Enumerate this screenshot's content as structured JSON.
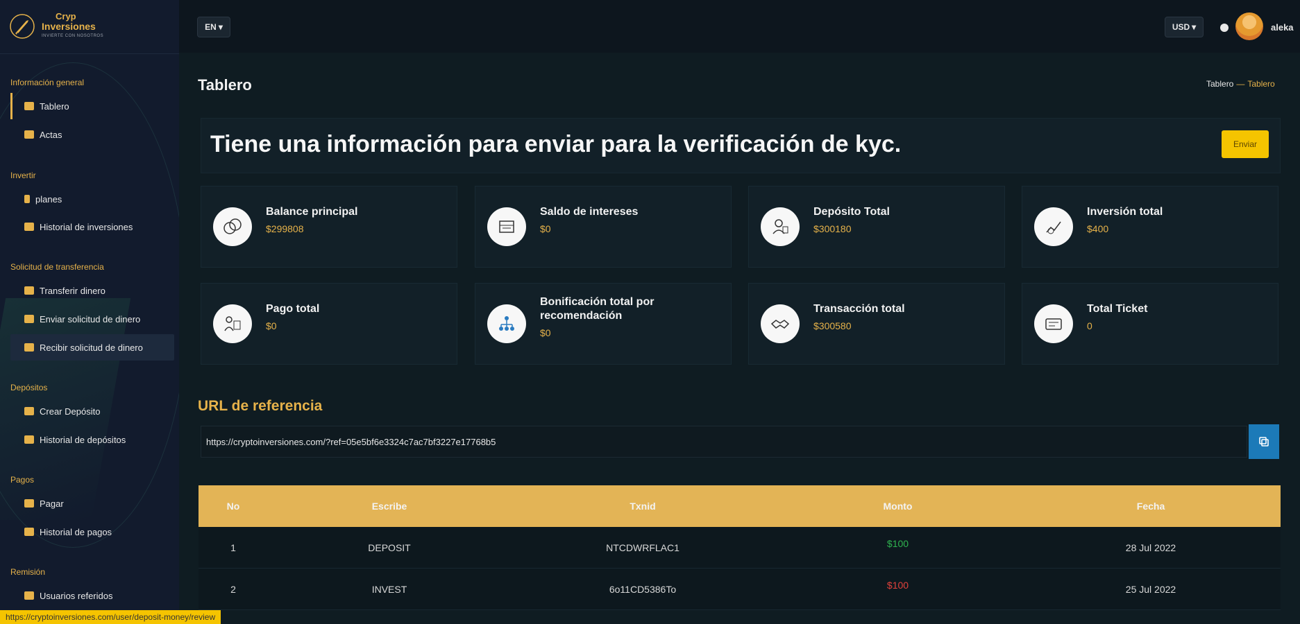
{
  "logo": {
    "line1": "Cryp",
    "line2": "Inversiones",
    "line3": "INVIERTE CON NOSOTROS"
  },
  "sidebar": {
    "sections": [
      {
        "label": "Información general",
        "items": [
          {
            "label": "Tablero",
            "icon": "dashboard-icon"
          },
          {
            "label": "Actas",
            "icon": "briefcase-icon"
          }
        ]
      },
      {
        "label": "Invertir",
        "items": [
          {
            "label": "planes",
            "icon": "flame-icon"
          },
          {
            "label": "Historial de inversiones",
            "icon": "chart-icon"
          }
        ]
      },
      {
        "label": "Solicitud de transferencia",
        "items": [
          {
            "label": "Transferir dinero",
            "icon": "transfer-icon"
          },
          {
            "label": "Enviar solicitud de dinero",
            "icon": "card-icon"
          },
          {
            "label": "Recibir solicitud de dinero",
            "icon": "wallet-icon"
          }
        ]
      },
      {
        "label": "Depósitos",
        "items": [
          {
            "label": "Crear Depósito",
            "icon": "cloud-upload-icon"
          },
          {
            "label": "Historial de depósitos",
            "icon": "history-icon"
          }
        ]
      },
      {
        "label": "Pagos",
        "items": [
          {
            "label": "Pagar",
            "icon": "lock-icon"
          },
          {
            "label": "Historial de pagos",
            "icon": "history-icon"
          }
        ]
      },
      {
        "label": "Remisión",
        "items": [
          {
            "label": "Usuarios referidos",
            "icon": "users-icon"
          }
        ]
      }
    ]
  },
  "status_url": "https://cryptoinversiones.com/user/deposit-money/review",
  "topbar": {
    "language": "EN",
    "currency": "USD",
    "username": "aleka"
  },
  "page": {
    "title": "Tablero",
    "breadcrumb": [
      "Tablero",
      "Tablero"
    ]
  },
  "kyc": {
    "message": "Tiene una información para enviar para la verificación de kyc.",
    "button": "Enviar"
  },
  "stats": [
    {
      "title": "Balance principal",
      "value": "$299808",
      "icon": "coins-icon"
    },
    {
      "title": "Saldo de intereses",
      "value": "$0",
      "icon": "bank-icon"
    },
    {
      "title": "Depósito Total",
      "value": "$300180",
      "icon": "deposit-icon"
    },
    {
      "title": "Inversión total",
      "value": "$400",
      "icon": "investment-icon"
    },
    {
      "title": "Pago total",
      "value": "$0",
      "icon": "payout-icon"
    },
    {
      "title": "Bonificación total por recomendación",
      "value": "$0",
      "icon": "referral-tree-icon"
    },
    {
      "title": "Transacción total",
      "value": "$300580",
      "icon": "handshake-icon"
    },
    {
      "title": "Total Ticket",
      "value": "0",
      "icon": "ticket-icon"
    }
  ],
  "referral": {
    "title": "URL de referencia",
    "url": "https://cryptoinversiones.com/?ref=05e5bf6e3324c7ac7bf3227e17768b5"
  },
  "table": {
    "headers": [
      "No",
      "Escribe",
      "Txnid",
      "Monto",
      "Fecha"
    ],
    "rows": [
      {
        "no": "1",
        "type": "DEPOSIT",
        "txnid": "NTCDWRFLAC1",
        "amount": "$100",
        "date": "28 Jul 2022",
        "status": "credit"
      },
      {
        "no": "2",
        "type": "INVEST",
        "txnid": "6o11CD5386To",
        "amount": "$100",
        "date": "25 Jul 2022",
        "status": "debit"
      }
    ]
  },
  "colors": {
    "accent": "#e6b24a",
    "button_yellow": "#f5c400",
    "copy_blue": "#1c7ab8",
    "credit": "#2fb24f",
    "debit": "#e0413b"
  }
}
